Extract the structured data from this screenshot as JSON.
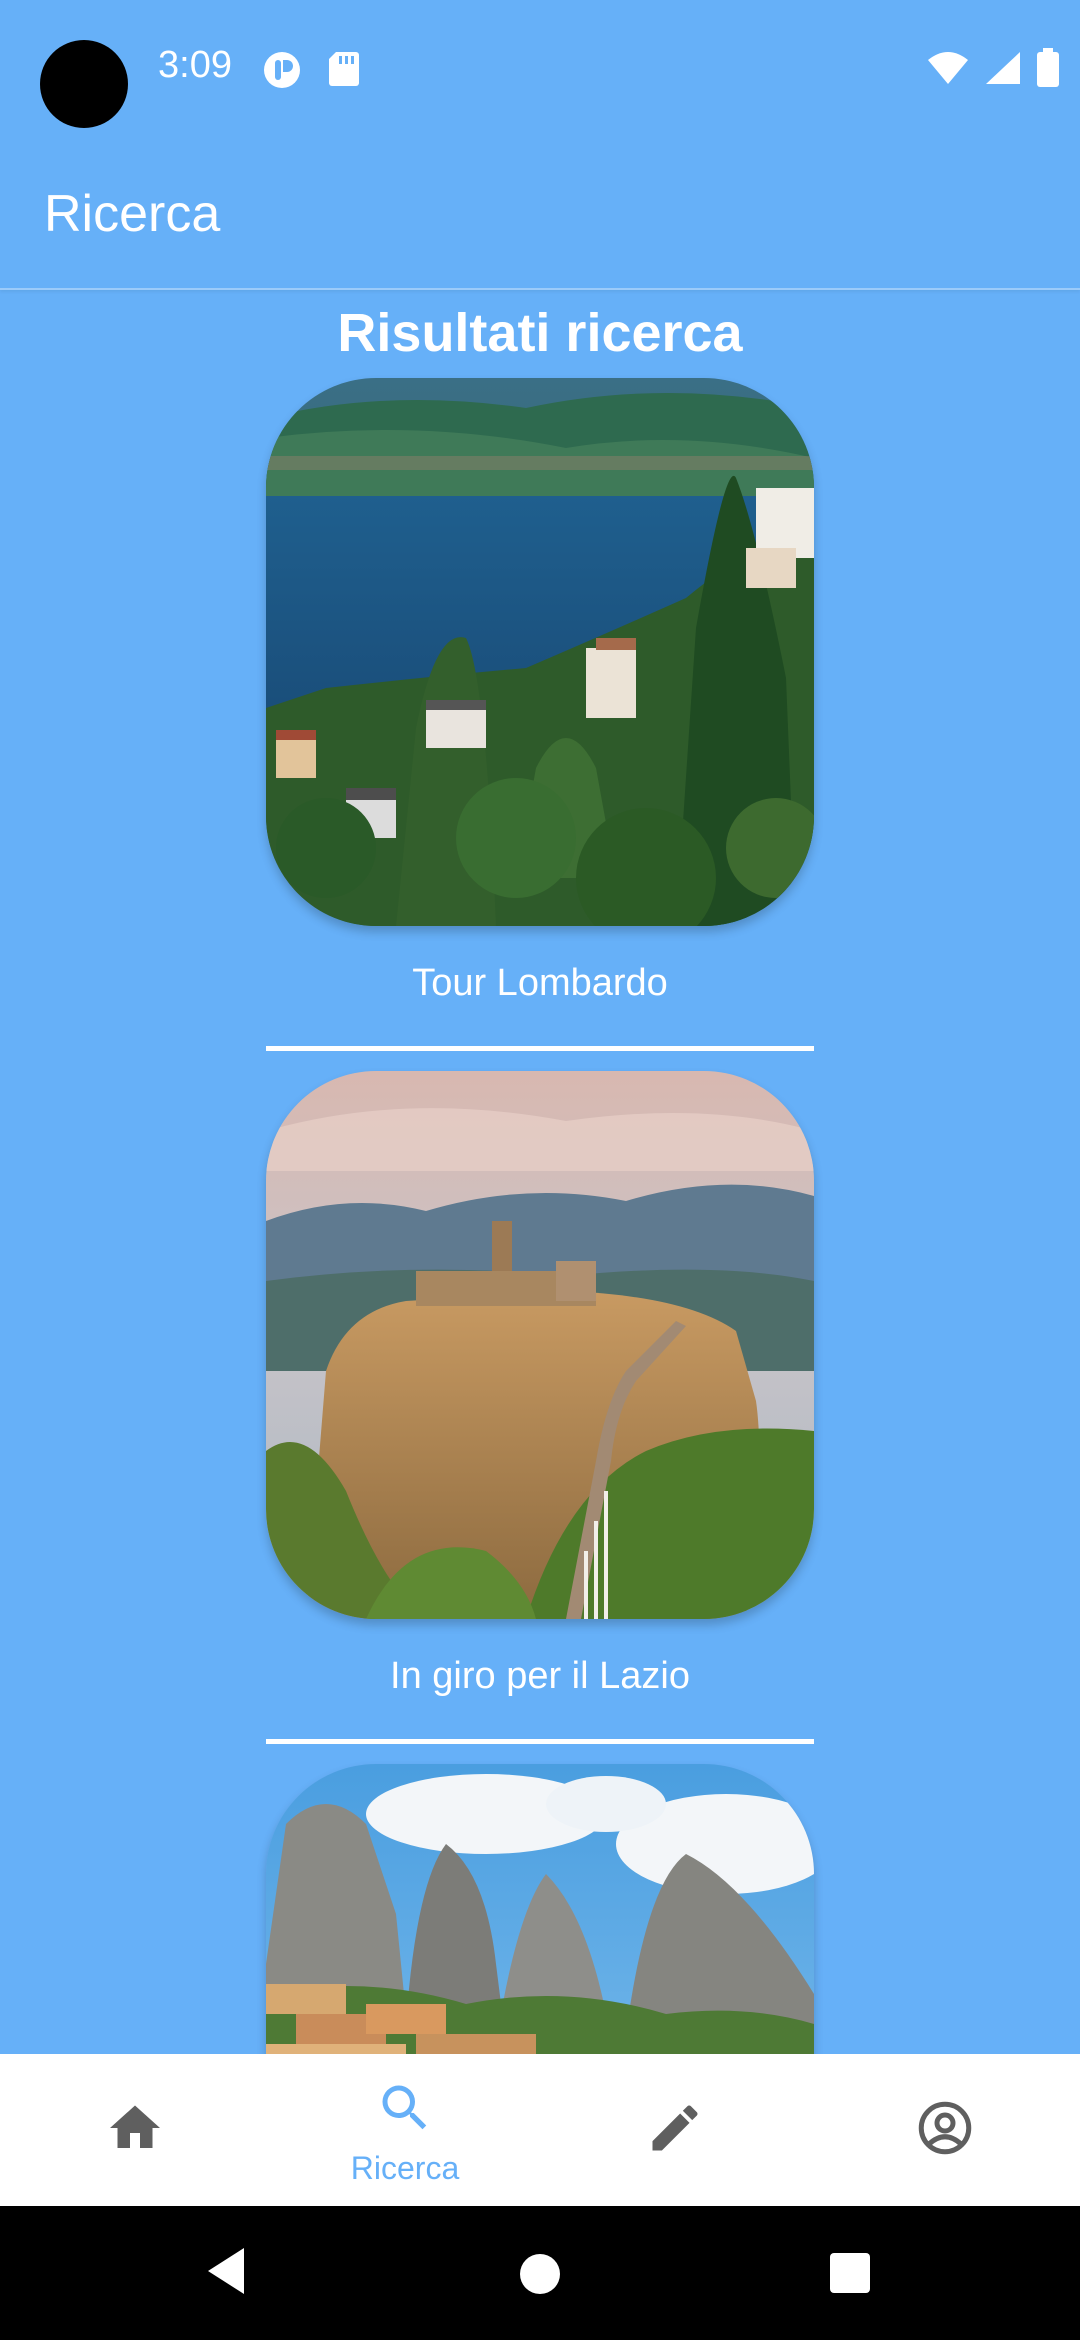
{
  "status_bar": {
    "time": "3:09"
  },
  "app_bar": {
    "title": "Ricerca"
  },
  "content": {
    "heading": "Risultati ricerca",
    "results": [
      {
        "label": "Tour Lombardo",
        "image": "lake-como-landscape"
      },
      {
        "label": "In giro per il Lazio",
        "image": "civita-di-bagnoregio-landscape"
      },
      {
        "label": "",
        "image": "castelmezzano-dolomites-landscape"
      }
    ]
  },
  "bottom_nav": {
    "items": [
      {
        "icon": "home-icon",
        "label": ""
      },
      {
        "icon": "search-icon",
        "label": "Ricerca",
        "active": true
      },
      {
        "icon": "edit-icon",
        "label": ""
      },
      {
        "icon": "account-icon",
        "label": ""
      }
    ],
    "active_color": "#66B0F8",
    "inactive_color": "#5F5F5F"
  },
  "theme": {
    "background": "#66B0F8",
    "text": "#FFFFFF"
  }
}
